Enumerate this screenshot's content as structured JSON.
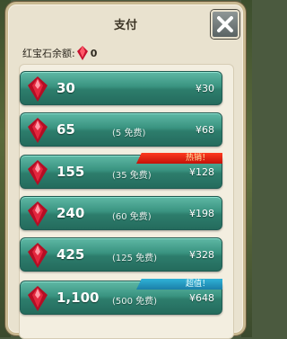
{
  "dialog": {
    "title": "支付",
    "close_icon": "close-x-icon",
    "balance_label": "红宝石余额:",
    "balance_value": "0"
  },
  "items": [
    {
      "amount": "30",
      "bonus": "",
      "price": "¥30",
      "tag": ""
    },
    {
      "amount": "65",
      "bonus": "(5 免费)",
      "price": "¥68",
      "tag": ""
    },
    {
      "amount": "155",
      "bonus": "(35 免费)",
      "price": "¥128",
      "tag": "热销！"
    },
    {
      "amount": "240",
      "bonus": "(60 免费)",
      "price": "¥198",
      "tag": ""
    },
    {
      "amount": "425",
      "bonus": "(125 免费)",
      "price": "¥328",
      "tag": ""
    },
    {
      "amount": "1,100",
      "bonus": "(500 免费)",
      "price": "¥648",
      "tag": "超值！"
    }
  ],
  "colors": {
    "button": "#399380",
    "hot_tag": "#d4150c",
    "value_tag": "#2596c4",
    "gem": "#c8102e"
  }
}
